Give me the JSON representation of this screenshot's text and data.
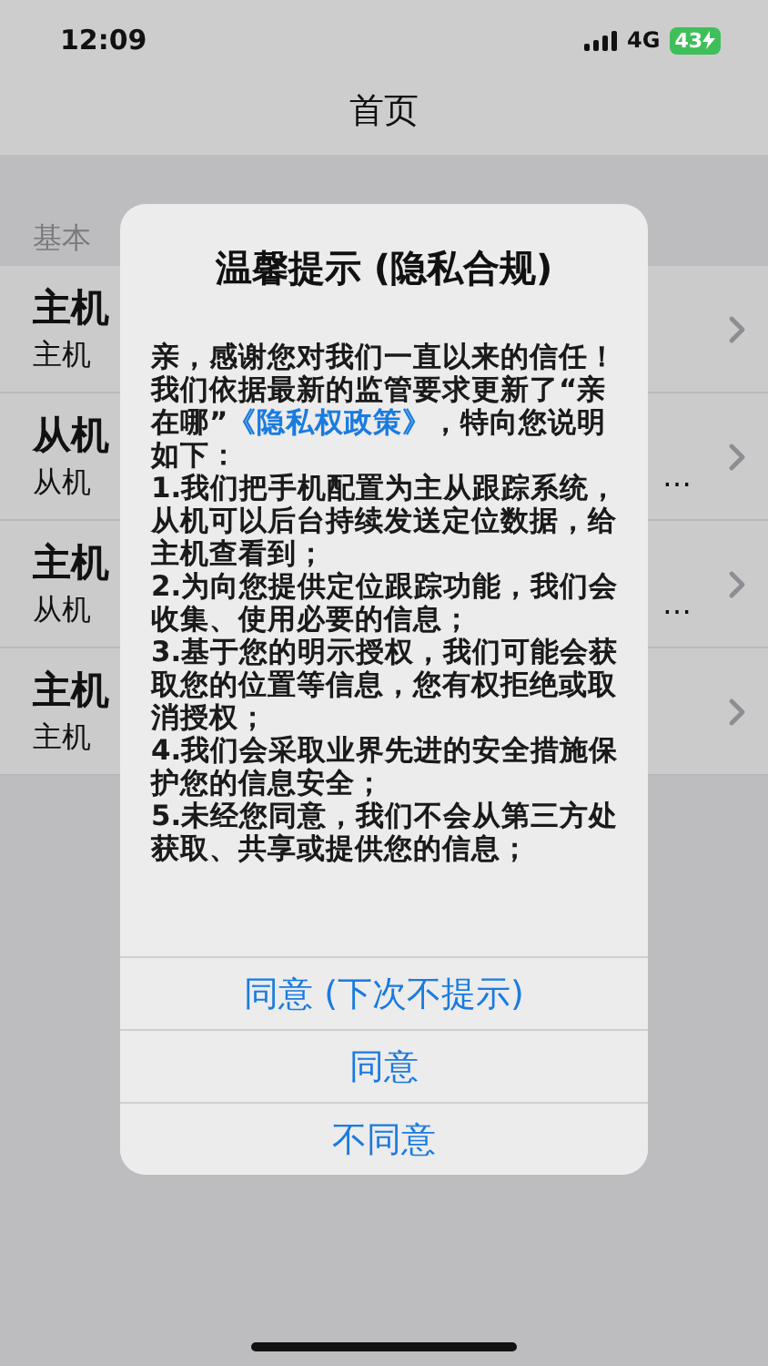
{
  "status_bar": {
    "time": "12:09",
    "network": "4G",
    "battery": "43"
  },
  "nav": {
    "title": "首页"
  },
  "section": {
    "header": "基本"
  },
  "rows": [
    {
      "title": "主机",
      "subtitle": "主机",
      "more": ""
    },
    {
      "title": "从机",
      "subtitle": "从机",
      "more": "…"
    },
    {
      "title": "主机",
      "subtitle": "从机",
      "more": "…"
    },
    {
      "title": "主机",
      "subtitle": "主机",
      "more": ""
    }
  ],
  "dialog": {
    "title": "温馨提示 (隐私合规)",
    "intro_before": "亲，感谢您对我们一直以来的信任！我们依据最新的监管要求更新了“亲在哪”",
    "link": "《隐私权政策》",
    "intro_after": "，特向您说明如下：",
    "points": [
      "1.我们把手机配置为主从跟踪系统，从机可以后台持续发送定位数据，给主机查看到；",
      "2.为向您提供定位跟踪功能，我们会收集、使用必要的信息；",
      "3.基于您的明示授权，我们可能会获取您的位置等信息，您有权拒绝或取消授权；",
      "4.我们会采取业界先进的安全措施保护您的信息安全；",
      "5.未经您同意，我们不会从第三方处获取、共享或提供您的信息；"
    ],
    "buttons": [
      "同意 (下次不提示)",
      "同意",
      "不同意"
    ]
  }
}
